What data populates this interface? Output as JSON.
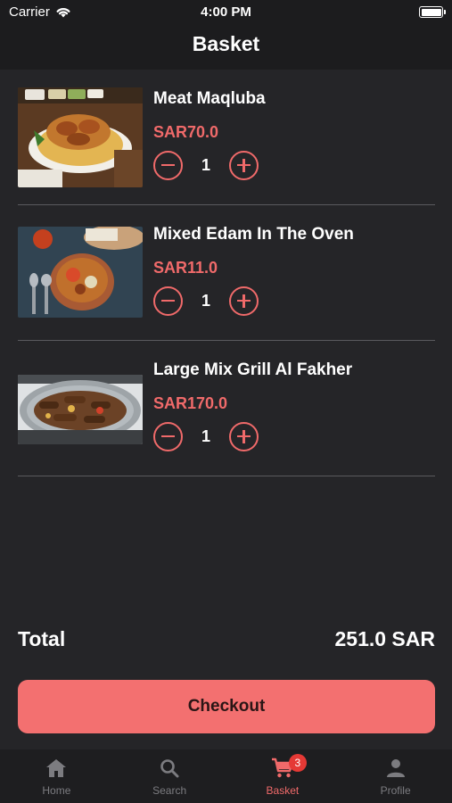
{
  "status_bar": {
    "carrier": "Carrier",
    "time": "4:00 PM"
  },
  "header": {
    "title": "Basket"
  },
  "items": [
    {
      "name": "Meat Maqluba",
      "price": "SAR70.0",
      "quantity": "1",
      "image_icon": "meat-maqluba-image"
    },
    {
      "name": "Mixed Edam In The Oven",
      "price": "SAR11.0",
      "quantity": "1",
      "image_icon": "mixed-edam-image"
    },
    {
      "name": "Large Mix Grill Al Fakher",
      "price": "SAR170.0",
      "quantity": "1",
      "image_icon": "mix-grill-image"
    }
  ],
  "summary": {
    "total_label": "Total",
    "total_value": "251.0 SAR"
  },
  "checkout": {
    "label": "Checkout"
  },
  "tabs": [
    {
      "label": "Home",
      "icon": "home-icon",
      "active": false
    },
    {
      "label": "Search",
      "icon": "search-icon",
      "active": false
    },
    {
      "label": "Basket",
      "icon": "cart-icon",
      "active": true,
      "badge": "3"
    },
    {
      "label": "Profile",
      "icon": "person-icon",
      "active": false
    }
  ],
  "colors": {
    "background": "#252528",
    "header": "#1c1c1e",
    "accent": "#f06a6a",
    "checkout_button": "#f37070",
    "badge": "#e53935",
    "inactive_tab": "#7c7c80"
  }
}
